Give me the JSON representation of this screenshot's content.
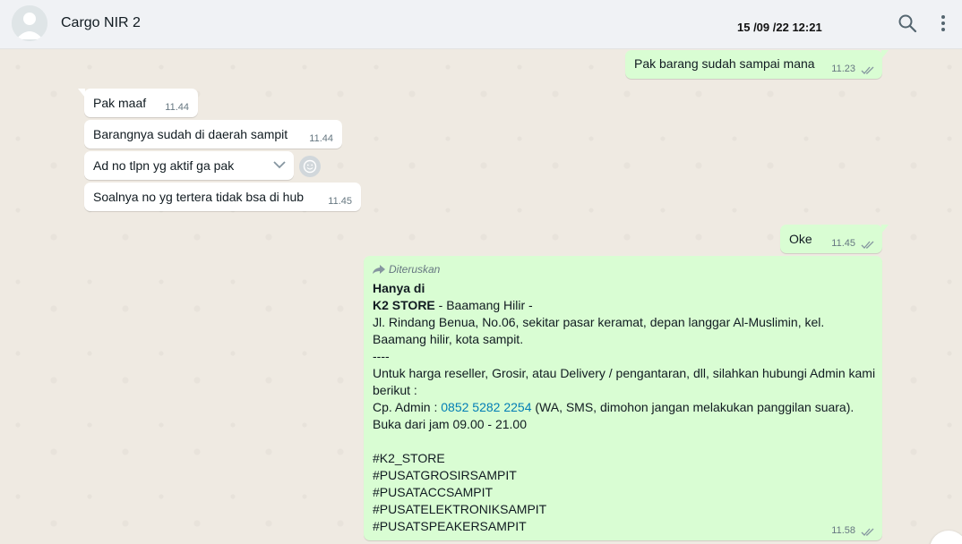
{
  "header": {
    "title": "Cargo NIR 2",
    "overlay_timestamp": "15 /09 /22 12:21"
  },
  "messages": {
    "m1": {
      "text": "Pak barang sudah sampai mana",
      "time": "11.23"
    },
    "m2": {
      "text": "Pak maaf",
      "time": "11.44"
    },
    "m3": {
      "text": "Barangnya sudah di daerah sampit",
      "time": "11.44"
    },
    "m4": {
      "text": "Ad no tlpn yg aktif ga pak"
    },
    "m5": {
      "text": "Soalnya no yg tertera tidak bsa di hub",
      "time": "11.45"
    },
    "m6": {
      "text": "Oke",
      "time": "11.45"
    },
    "m7": {
      "forwarded_label": "Diteruskan",
      "line1": "Hanya di",
      "store_name": "K2 STORE",
      "store_suffix": " - Baamang Hilir -",
      "address": "Jl. Rindang Benua, No.06, sekitar pasar keramat, depan langgar Al-Muslimin, kel. Baamang hilir, kota sampit.",
      "divider": "----",
      "info": "Untuk harga reseller, Grosir, atau Delivery / pengantaran, dll, silahkan hubungi Admin kami berikut :",
      "cp_prefix": "Cp. Admin : ",
      "phone": "0852 5282 2254",
      "cp_suffix": " (WA, SMS, dimohon jangan melakukan panggilan suara).",
      "hours": "Buka dari jam 09.00 - 21.00",
      "tags": [
        "#K2_STORE",
        "#PUSATGROSIRSAMPIT",
        "#PUSATACCSAMPIT",
        "#PUSATELEKTRONIKSAMPIT",
        "#PUSATSPEAKERSAMPIT"
      ],
      "time": "11.58"
    }
  },
  "colors": {
    "outgoing_bubble": "#d9fdd3",
    "incoming_bubble": "#ffffff",
    "link": "#027eb5"
  }
}
